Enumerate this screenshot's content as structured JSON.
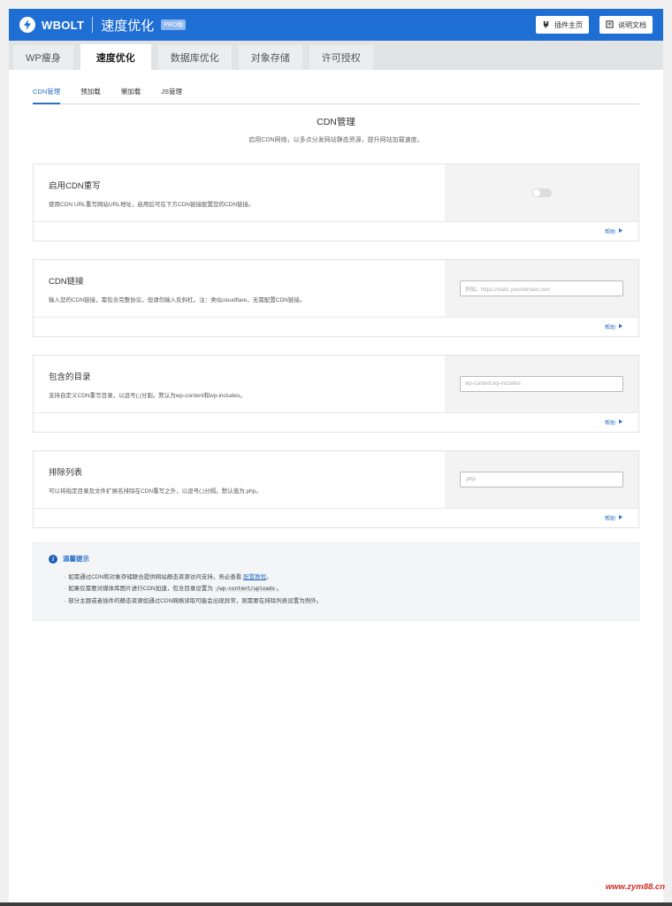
{
  "header": {
    "brand": "WBOLT",
    "title": "速度优化",
    "badge": "PRO版",
    "buttons": [
      {
        "label": "插件主页",
        "icon": "plugin-icon"
      },
      {
        "label": "说明文档",
        "icon": "document-icon"
      }
    ],
    "color": "#1f6ed4"
  },
  "tabs": [
    {
      "label": "WP瘦身",
      "active": false
    },
    {
      "label": "速度优化",
      "active": true
    },
    {
      "label": "数据库优化",
      "active": false
    },
    {
      "label": "对象存储",
      "active": false
    },
    {
      "label": "许可授权",
      "active": false
    }
  ],
  "subtabs": [
    {
      "label": "CDN管理",
      "active": true
    },
    {
      "label": "预加载",
      "active": false
    },
    {
      "label": "懒加载",
      "active": false
    },
    {
      "label": "JS管理",
      "active": false
    }
  ],
  "section": {
    "title": "CDN管理",
    "desc": "启用CDN网络，以多点分发网站静态资源，提升网站加载速度。"
  },
  "cards": {
    "enable": {
      "title": "启用CDN重写",
      "desc": "使用CDN URL重写网站URL地址，启用后可在下方CDN链接配置您的CDN链接。",
      "toggle_on": false,
      "help": "帮助"
    },
    "cdn_link": {
      "title": "CDN链接",
      "desc": "输入您的CDN链接，需包含完整协议，但请勿输入反斜杠。注：类似cloudflare，无需配置CDN链接。",
      "placeholder": "例如。https://static.yourdomain.com",
      "help": "帮助"
    },
    "include_dirs": {
      "title": "包含的目录",
      "desc": "支持自定义CDN重写目录，以逗号(,)分割。默认为wp-content和wp-includes。",
      "placeholder": "wp-content,wp-includes",
      "help": "帮助"
    },
    "exclude": {
      "title": "排除列表",
      "desc": "可以将指定目录及文件扩展名排除在CDN重写之外，以逗号(,)分隔。默认值为.php。",
      "placeholder": ".php",
      "help": "帮助"
    }
  },
  "tips": {
    "title": "温馨提示",
    "line1_a": "如需通过CDN和对象存储联合提供网站静态资源访问支持，务必查看",
    "line1_link": "配置教程",
    "line1_b": "。",
    "line2_a": "如果仅需要对媒体库图片进行CDN加速，包含目录设置为",
    "line2_code": "/wp-content/uploads",
    "line2_b": "。",
    "line3": "部分主题或者插件的静态资源如通过CDN网络读取可能会出现异常，则需要在排除列表设置为例外。"
  },
  "watermark": "www.zym88.cn"
}
